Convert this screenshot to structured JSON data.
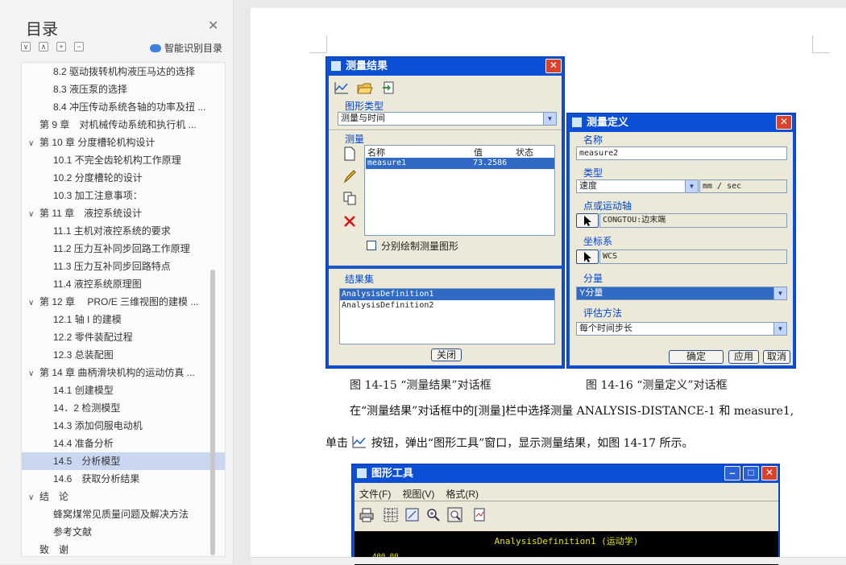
{
  "toc": {
    "title": "目录",
    "smart_label": "智能识别目录",
    "items": [
      {
        "label": "8.2 驱动拨转机构液压马达的选择",
        "level": 2,
        "arrow": ""
      },
      {
        "label": "8.3 液压泵的选择",
        "level": 2,
        "arrow": ""
      },
      {
        "label": "8.4 冲压传动系统各轴的功率及扭 ...",
        "level": 2,
        "arrow": ""
      },
      {
        "label": "第 9 章　对机械传动系统和执行机 ...",
        "level": 1,
        "arrow": ""
      },
      {
        "label": "第 10 章  分度槽轮机构设计",
        "level": 1,
        "arrow": "∨"
      },
      {
        "label": "10.1 不完全齿轮机构工作原理",
        "level": 2,
        "arrow": ""
      },
      {
        "label": "10.2 分度槽轮的设计",
        "level": 2,
        "arrow": ""
      },
      {
        "label": "10.3 加工注意事项：",
        "level": 2,
        "arrow": ""
      },
      {
        "label": "第 11 章　液控系统设计",
        "level": 1,
        "arrow": "∨"
      },
      {
        "label": "11.1 主机对液控系统的要求",
        "level": 2,
        "arrow": ""
      },
      {
        "label": "11.2 压力互补同步回路工作原理",
        "level": 2,
        "arrow": ""
      },
      {
        "label": "11.3 压力互补同步回路特点",
        "level": 2,
        "arrow": ""
      },
      {
        "label": "11.4 液控系统原理图",
        "level": 2,
        "arrow": ""
      },
      {
        "label": "第 12 章　 PRO/E 三维视图的建模 ...",
        "level": 1,
        "arrow": "∨"
      },
      {
        "label": "12.1 轴 I 的建模",
        "level": 2,
        "arrow": ""
      },
      {
        "label": "12.2 零件装配过程",
        "level": 2,
        "arrow": ""
      },
      {
        "label": "12.3 总装配图",
        "level": 2,
        "arrow": ""
      },
      {
        "label": "第 14  章  曲柄滑块机构的运动仿真 ...",
        "level": 1,
        "arrow": "∨"
      },
      {
        "label": "14.1  创建模型",
        "level": 2,
        "arrow": ""
      },
      {
        "label": "14．2  检测模型",
        "level": 2,
        "arrow": ""
      },
      {
        "label": "14.3  添加伺服电动机",
        "level": 2,
        "arrow": ""
      },
      {
        "label": "14.4  准备分析",
        "level": 2,
        "arrow": ""
      },
      {
        "label": "14.5　分析模型",
        "level": 2,
        "arrow": "",
        "selected": true
      },
      {
        "label": "14.6　获取分析结果",
        "level": 2,
        "arrow": ""
      },
      {
        "label": "结　论",
        "level": 1,
        "arrow": "∨"
      },
      {
        "label": "蜂窝煤常见质量问题及解决方法",
        "level": 2,
        "arrow": ""
      },
      {
        "label": "参考文献",
        "level": 2,
        "arrow": ""
      },
      {
        "label": "致　谢",
        "level": 1,
        "arrow": ""
      }
    ]
  },
  "measure_result": {
    "title": "测量结果",
    "chart_type_label": "图形类型",
    "chart_type_value": "测量与时间",
    "measure_label": "测量",
    "col_name": "名称",
    "col_value": "值",
    "col_status": "状态",
    "row_name": "measure1",
    "row_value": "73.2586",
    "row_status": "",
    "separate_label": "分别绘制测量图形",
    "result_set_label": "结果集",
    "results": [
      "AnalysisDefinition1",
      "AnalysisDefinition2"
    ],
    "close_label": "关闭"
  },
  "measure_def": {
    "title": "测量定义",
    "name_label": "名称",
    "name_value": "measure2",
    "type_label": "类型",
    "type_value": "速度",
    "unit": "mm / sec",
    "point_label": "点或运动轴",
    "point_value": "CONGTOU:边末端",
    "coord_label": "坐标系",
    "coord_value": "WCS",
    "component_label": "分量",
    "component_value": "Y分量",
    "eval_label": "评估方法",
    "eval_value": "每个时间步长",
    "ok_label": "确定",
    "apply_label": "应用",
    "cancel_label": "取消"
  },
  "captions": {
    "fig15": "图 14-15 “测量结果”对话框",
    "fig16": "图 14-16 “测量定义”对话框"
  },
  "body": {
    "line1": "在“测量结果”对话框中的[测量]栏中选择测量 ANALYSIS-DISTANCE-1 和 measure1,",
    "line2_a": "单击",
    "line2_b": "按钮，弹出“图形工具”窗口，显示测量结果，如图 14-17 所示。"
  },
  "graph_tool": {
    "title": "图形工具",
    "menu": [
      "文件(F)",
      "视图(V)",
      "格式(R)"
    ],
    "chart_title": "AnalysisDefinition1 (运动学)",
    "y_top": "400.00"
  }
}
